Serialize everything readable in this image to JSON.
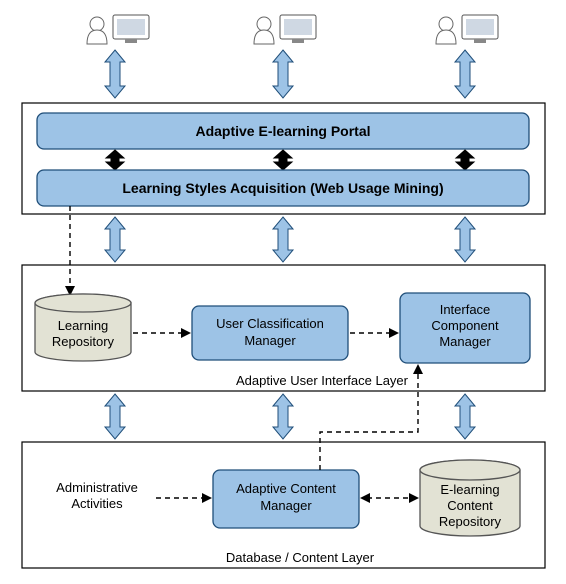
{
  "top": {
    "portal": "Adaptive E-learning Portal",
    "acquisition": "Learning Styles Acquisition (Web Usage Mining)"
  },
  "ui_layer": {
    "label": "Adaptive User Interface Layer",
    "learning_repo_l1": "Learning",
    "learning_repo_l2": "Repository",
    "user_class_l1": "User Classification",
    "user_class_l2": "Manager",
    "iface_l1": "Interface",
    "iface_l2": "Component",
    "iface_l3": "Manager"
  },
  "content_layer": {
    "label": "Database / Content Layer",
    "admin_l1": "Administrative",
    "admin_l2": "Activities",
    "adaptive_l1": "Adaptive Content",
    "adaptive_l2": "Manager",
    "repo_l1": "E-learning",
    "repo_l2": "Content",
    "repo_l3": "Repository"
  }
}
